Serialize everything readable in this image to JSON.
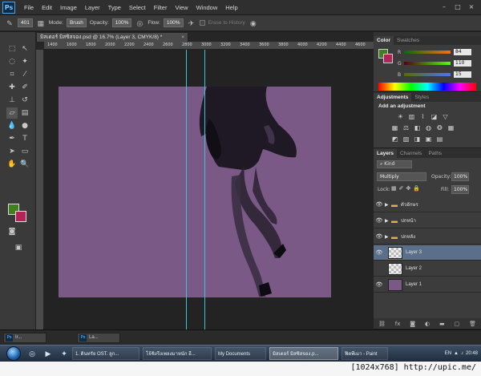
{
  "app": {
    "logo": "Ps",
    "menu": [
      "File",
      "Edit",
      "Image",
      "Layer",
      "Type",
      "Select",
      "Filter",
      "View",
      "Window",
      "Help"
    ],
    "window_controls": [
      "–",
      "□",
      "×"
    ]
  },
  "options_bar": {
    "brush_size": "401",
    "mode_label": "Mode:",
    "mode_value": "Brush",
    "opacity_label": "Opacity:",
    "opacity_value": "100%",
    "flow_label": "Flow:",
    "flow_value": "100%",
    "erase_to_history": "Erase to History"
  },
  "document": {
    "tab_title": "มิสเตอร์ มิสซิสจอง.psd @ 16.7% (Layer 3, CMYK/8) *",
    "tab_close": "×",
    "ruler_ticks": [
      "1400",
      "1600",
      "1800",
      "2000",
      "2200",
      "2400",
      "2600",
      "2800",
      "3000",
      "3200",
      "3400",
      "3600",
      "3800",
      "4000",
      "4200",
      "4400",
      "4600"
    ],
    "canvas_color": "#7a5986",
    "guide_color": "#38c6d6"
  },
  "colors": {
    "foreground": "#3f7f1e",
    "background": "#b32358"
  },
  "color_panel": {
    "tabs": [
      "Color",
      "Swatches"
    ],
    "sliders": [
      {
        "letter": "R",
        "value": "84"
      },
      {
        "letter": "G",
        "value": "110"
      },
      {
        "letter": "B",
        "value": "15"
      }
    ]
  },
  "adjustments_panel": {
    "tabs": [
      "Adjustments",
      "Styles"
    ],
    "heading": "Add an adjustment"
  },
  "layers_panel": {
    "tabs": [
      "Layers",
      "Channels",
      "Paths"
    ],
    "filter_kind": "Kind",
    "blend_mode": "Multiply",
    "opacity_label": "Opacity:",
    "opacity_value": "100%",
    "lock_label": "Lock:",
    "fill_label": "Fill:",
    "fill_value": "100%",
    "layers": [
      {
        "name": "ตัวอักษร",
        "type": "group",
        "visible": true,
        "selected": false
      },
      {
        "name": "ปกหน้า",
        "type": "group",
        "visible": true,
        "selected": false
      },
      {
        "name": "ปกหลัง",
        "type": "group",
        "visible": true,
        "selected": false
      },
      {
        "name": "Layer 3",
        "type": "pixel",
        "visible": true,
        "selected": true
      },
      {
        "name": "Layer 2",
        "type": "pixel",
        "visible": false,
        "selected": false
      },
      {
        "name": "Layer 1",
        "type": "pixel",
        "visible": true,
        "selected": false
      }
    ]
  },
  "minimized_docs": [
    {
      "label": "Ir..."
    },
    {
      "label": "La..."
    }
  ],
  "taskbar": {
    "buttons": [
      {
        "label": "1. ดินทรัย OST. ลูก...",
        "active": false
      },
      {
        "label": "โจ้ชิงรีงเพลงมาหนัก อี...",
        "active": false
      },
      {
        "label": "My Documents",
        "active": false
      },
      {
        "label": "มิสเตอร์ มิสซิสจอง.p...",
        "active": true
      },
      {
        "label": "ฟิตพีเมา - Paint",
        "active": false
      }
    ],
    "lang": "EN",
    "time": "20:48"
  },
  "watermark": "[1024x768] http://upic.me/"
}
